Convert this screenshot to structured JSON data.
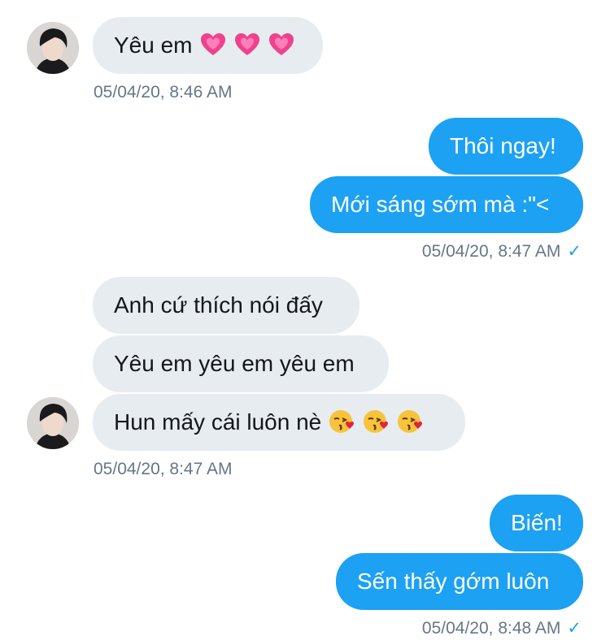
{
  "conversation": {
    "group1": {
      "message": "Yêu em",
      "emoji": [
        "growing-heart-icon",
        "growing-heart-icon",
        "growing-heart-icon"
      ],
      "timestamp": "05/04/20, 8:46 AM"
    },
    "group2": {
      "messages": [
        "Thôi ngay!",
        "Mới sáng sớm mà :\"<"
      ],
      "timestamp": "05/04/20, 8:47 AM",
      "read_mark": "✓"
    },
    "group3": {
      "messages": [
        "Anh cứ thích nói đấy",
        "Yêu em yêu em yêu em",
        "Hun mấy cái luôn nè"
      ],
      "emoji": [
        "kissing-face-icon",
        "kissing-face-icon",
        "kissing-face-icon"
      ],
      "timestamp": "05/04/20, 8:47 AM"
    },
    "group4": {
      "messages": [
        "Biến!",
        "Sến thấy gớm luôn"
      ],
      "timestamp": "05/04/20, 8:48 AM",
      "read_mark": "✓"
    }
  },
  "colors": {
    "sent_bubble": "#1da1f2",
    "received_bubble": "#e6ecf0",
    "timestamp": "#657786",
    "received_text": "#14171a"
  }
}
